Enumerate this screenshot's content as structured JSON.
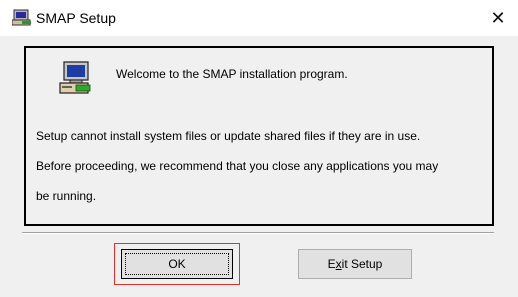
{
  "window": {
    "title": "SMAP Setup",
    "close_glyph": "✕"
  },
  "dialog": {
    "welcome_text": "Welcome to the SMAP installation program.",
    "body_lines": [
      "Setup cannot install system files or update shared files if they are in use.",
      "Before proceeding, we recommend that you close any applications you may",
      "be running."
    ]
  },
  "buttons": {
    "ok_label": "OK",
    "exit_pre": "E",
    "exit_mnemonic": "x",
    "exit_post": "it Setup"
  },
  "icons": {
    "title": "setup-computer-icon",
    "panel": "setup-computer-icon"
  },
  "colors": {
    "highlight": "#e03030",
    "face": "#f0f0f0"
  }
}
